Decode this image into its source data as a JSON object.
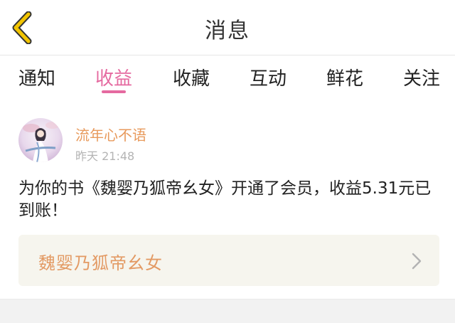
{
  "header": {
    "title": "消息",
    "back_icon": "chevron-left-icon",
    "accent": "#f2c400"
  },
  "tabs": [
    {
      "label": "通知",
      "active": false
    },
    {
      "label": "收益",
      "active": true
    },
    {
      "label": "收藏",
      "active": false
    },
    {
      "label": "互动",
      "active": false
    },
    {
      "label": "鲜花",
      "active": false
    },
    {
      "label": "关注",
      "active": false
    }
  ],
  "active_color": "#e56aa0",
  "notification": {
    "username": "流年心不语",
    "time": "昨天 21:48",
    "message": "为你的书《魏婴乃狐帝幺女》开通了会员，收益5.31元已到账！",
    "book_title": "魏婴乃狐帝幺女",
    "chevron_icon": "chevron-right-icon"
  }
}
